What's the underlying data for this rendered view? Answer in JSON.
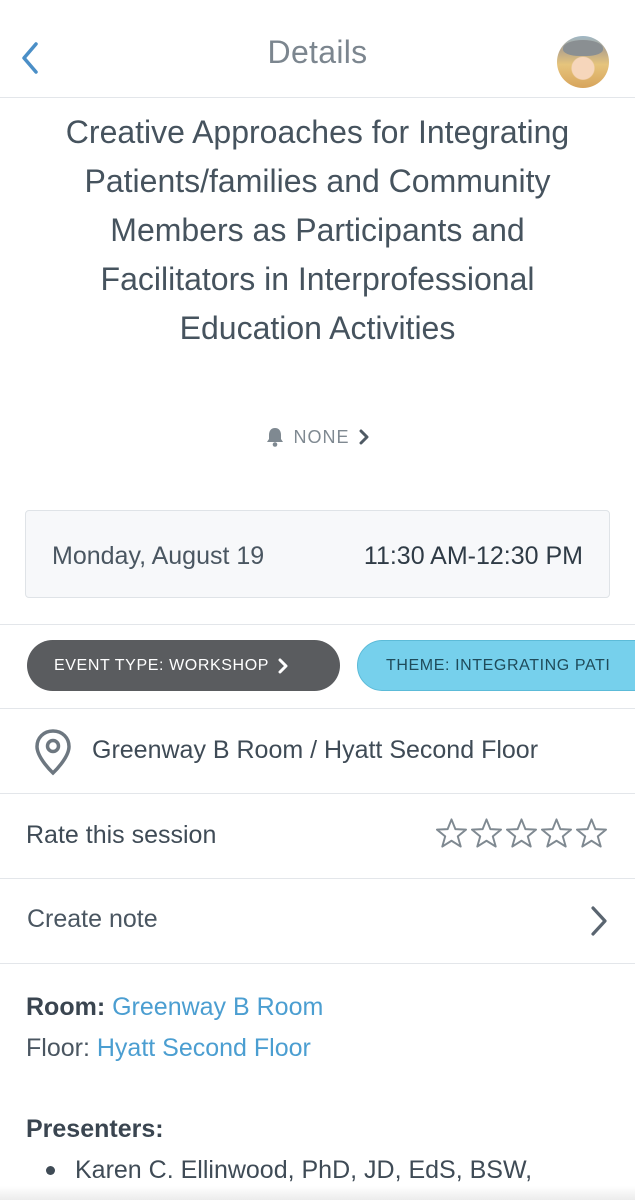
{
  "header": {
    "title": "Details"
  },
  "session": {
    "title": "Creative Approaches for Integrating Patients/families and Community Members as Participants and Facilitators in Interprofessional Education Activities",
    "reminder_label": "NONE",
    "date": "Monday, August 19",
    "time": "11:30 AM-12:30 PM"
  },
  "tags": {
    "event_type": "EVENT TYPE: WORKSHOP",
    "theme": "THEME: INTEGRATING PATI"
  },
  "location": {
    "text": "Greenway B Room / Hyatt Second Floor"
  },
  "rating": {
    "label": "Rate this session",
    "value": 0,
    "max": 5
  },
  "note": {
    "label": "Create note"
  },
  "details": {
    "room_label": "Room:",
    "room_value": "Greenway B Room",
    "floor_label": "Floor:",
    "floor_value": "Hyatt Second Floor",
    "presenters_label": "Presenters:",
    "presenters": [
      "Karen C. Ellinwood, PhD, JD, EdS, BSW,"
    ]
  },
  "colors": {
    "link": "#4b9ed1",
    "event_chip": "#5a5c5f",
    "theme_chip": "#76d0ec"
  },
  "icons": {
    "back": "chevron-left-icon",
    "reminder": "bell-icon",
    "location": "map-pin-icon",
    "rating": "star-outline-icon",
    "note": "chevron-right-icon"
  }
}
